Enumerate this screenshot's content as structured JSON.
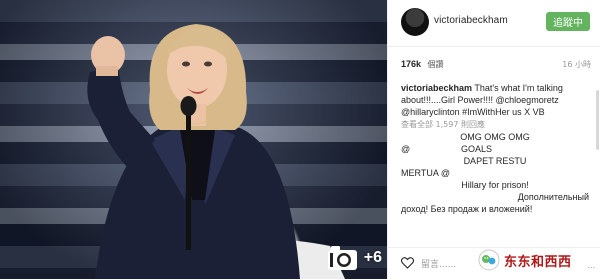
{
  "post": {
    "photo_count": "+6"
  },
  "header": {
    "username": "victoriabeckham",
    "follow_label": "追蹤中"
  },
  "stats": {
    "likes": "176k",
    "likes_label": "個讚",
    "time": "16 小時"
  },
  "caption": {
    "user": "victoriabeckham",
    "text": "That's what I'm talking about!!!....Girl Power!!!! @chloegmoretz @hillaryclinton #ImWithHer us X VB",
    "view_all": "查看全部 1,597 則回應"
  },
  "comments": [
    {
      "user": "",
      "text": "OMG OMG OMG"
    },
    {
      "user": "@",
      "text": "GOALS"
    },
    {
      "user": "",
      "text": "DAPET RESTU"
    },
    {
      "user": "MERTUA @",
      "text": ""
    },
    {
      "user": "",
      "text": "Hillary for prison!"
    },
    {
      "user": "",
      "text": "Дополнительный"
    },
    {
      "user": "",
      "text": "доход! Без продаж и вложений!"
    }
  ],
  "footer": {
    "comment_placeholder": "留言......",
    "watermark_text": "东东和西西",
    "more": "..."
  },
  "colors": {
    "follow_button": "#64b35f",
    "watermark": "#b01818"
  }
}
